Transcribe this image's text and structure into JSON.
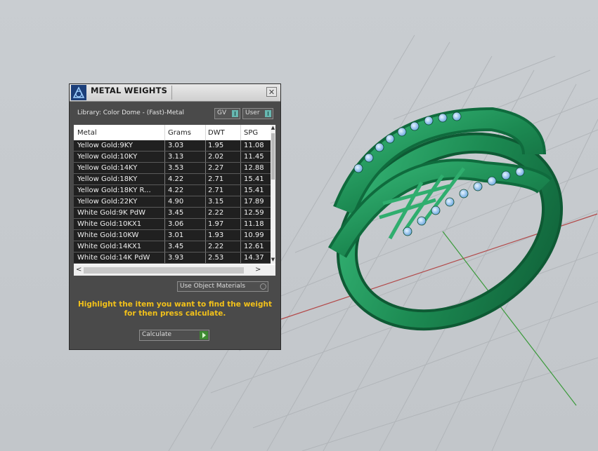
{
  "window": {
    "title": "METAL WEIGHTS",
    "close_icon": "close-icon"
  },
  "library_label": "Library: Color Dome - (Fast)-Metal",
  "toggles": {
    "gv_label": "GV",
    "user_label": "User"
  },
  "table": {
    "headers": [
      "Metal",
      "Grams",
      "DWT",
      "SPG"
    ],
    "rows": [
      [
        "Yellow Gold:9KY",
        "3.03",
        "1.95",
        "11.08"
      ],
      [
        "Yellow Gold:10KY",
        "3.13",
        "2.02",
        "11.45"
      ],
      [
        "Yellow Gold:14KY",
        "3.53",
        "2.27",
        "12.88"
      ],
      [
        "Yellow Gold:18KY",
        "4.22",
        "2.71",
        "15.41"
      ],
      [
        "Yellow Gold:18KY R...",
        "4.22",
        "2.71",
        "15.41"
      ],
      [
        "Yellow Gold:22KY",
        "4.90",
        "3.15",
        "17.89"
      ],
      [
        "White Gold:9K PdW",
        "3.45",
        "2.22",
        "12.59"
      ],
      [
        "White Gold:10KX1",
        "3.06",
        "1.97",
        "11.18"
      ],
      [
        "White Gold:10KW",
        "3.01",
        "1.93",
        "10.99"
      ],
      [
        "White Gold:14KX1",
        "3.45",
        "2.22",
        "12.61"
      ],
      [
        "White Gold:14K PdW",
        "3.93",
        "2.53",
        "14.37"
      ]
    ]
  },
  "use_object_materials_label": "Use Object Materials",
  "hint": "Highlight the item you want to find the weight for then press calculate.",
  "calculate_label": "Calculate",
  "colors": {
    "panel_bg": "#4a4a4a",
    "hint_text": "#f2c11a",
    "ring": "#1f8a55",
    "gems": "#9cc8ef"
  }
}
